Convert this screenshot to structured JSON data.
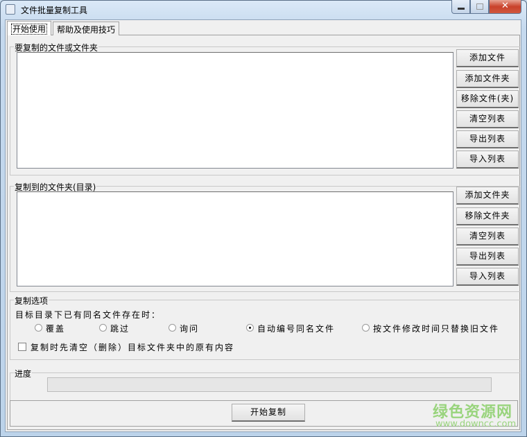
{
  "window": {
    "title": "文件批量复制工具",
    "controls": [
      "minimize",
      "maximize",
      "close"
    ]
  },
  "tabs": [
    {
      "label": "开始使用",
      "active": true
    },
    {
      "label": "帮助及使用技巧",
      "active": false
    }
  ],
  "source_group": {
    "label": "要复制的文件或文件夹",
    "buttons": [
      "添加文件",
      "添加文件夹",
      "移除文件(夹)",
      "清空列表",
      "导出列表",
      "导入列表"
    ]
  },
  "dest_group": {
    "label": "复制到的文件夹(目录)",
    "buttons": [
      "添加文件夹",
      "移除文件夹",
      "清空列表",
      "导出列表",
      "导入列表"
    ]
  },
  "options": {
    "label": "复制选项",
    "prompt": "目标目录下已有同名文件存在时：",
    "radios": [
      {
        "label": "覆盖",
        "checked": false
      },
      {
        "label": "跳过",
        "checked": false
      },
      {
        "label": "询问",
        "checked": false
      },
      {
        "label": "自动编号同名文件",
        "checked": true
      },
      {
        "label": "按文件修改时间只替换旧文件",
        "checked": false
      }
    ],
    "checkbox": {
      "label": "复制时先清空（删除）目标文件夹中的原有内容",
      "checked": false
    }
  },
  "progress": {
    "label": "进度",
    "value_percent": 0
  },
  "start_button": "开始复制",
  "watermark": {
    "name": "绿色资源网",
    "url": "www.downcc.com"
  }
}
